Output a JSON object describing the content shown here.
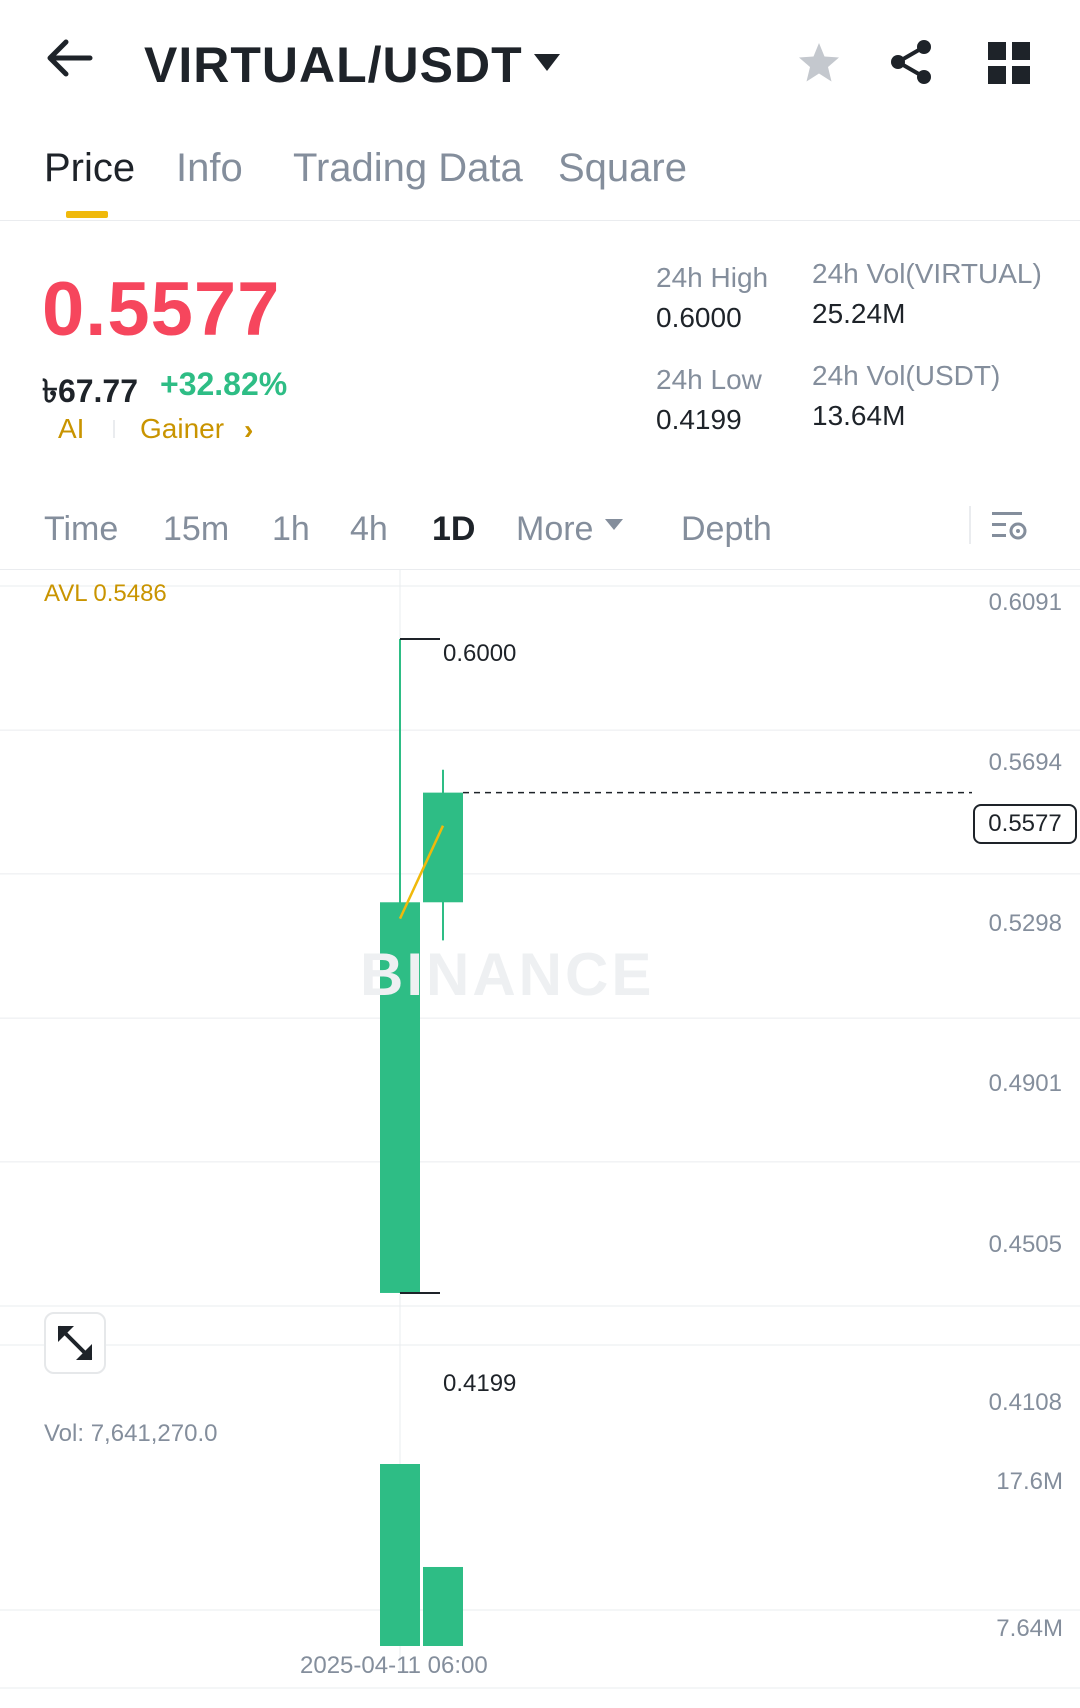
{
  "header": {
    "pair": "VIRTUAL/USDT",
    "icons": [
      "back-arrow-icon",
      "caret-down-icon",
      "star-icon",
      "share-icon",
      "grid-icon"
    ]
  },
  "tabs": [
    {
      "label": "Price",
      "active": true
    },
    {
      "label": "Info",
      "active": false
    },
    {
      "label": "Trading Data",
      "active": false
    },
    {
      "label": "Square",
      "active": false
    }
  ],
  "ticker": {
    "last_price": "0.5577",
    "fiat_price": "৳67.77",
    "change_pct": "+32.82%",
    "tags": [
      "AI",
      "Gainer"
    ],
    "tag_chevron": "›",
    "high_label": "24h High",
    "high_value": "0.6000",
    "low_label": "24h Low",
    "low_value": "0.4199",
    "vol_base_label": "24h Vol(VIRTUAL)",
    "vol_base_value": "25.24M",
    "vol_quote_label": "24h Vol(USDT)",
    "vol_quote_value": "13.64M"
  },
  "intervals": [
    {
      "label": "Time",
      "active": false
    },
    {
      "label": "15m",
      "active": false
    },
    {
      "label": "1h",
      "active": false
    },
    {
      "label": "4h",
      "active": false
    },
    {
      "label": "1D",
      "active": true
    },
    {
      "label": "More",
      "active": false
    },
    {
      "label": "Depth",
      "active": false
    }
  ],
  "chart": {
    "avl_label": "AVL 0.5486",
    "watermark": "BINANCE",
    "current_price_tag": "0.5577",
    "high_marker": "0.6000",
    "low_marker": "0.4199",
    "vol_label": "Vol: 7,641,270.0",
    "date_label": "2025-04-11 06:00"
  },
  "chart_data": {
    "type": "candlestick",
    "price_axis_ticks": [
      "0.6091",
      "0.5694",
      "0.5298",
      "0.4901",
      "0.4505",
      "0.4108"
    ],
    "volume_axis_ticks": [
      "17.6M",
      "7.64M"
    ],
    "ylim": [
      0.4108,
      0.6091
    ],
    "candles": [
      {
        "open": 0.4199,
        "high": 0.6,
        "low": 0.4199,
        "close": 0.5275,
        "volume": 17600000,
        "color": "#2ebd85"
      },
      {
        "open": 0.5275,
        "high": 0.564,
        "low": 0.517,
        "close": 0.5577,
        "volume": 7641270,
        "color": "#2ebd85"
      }
    ],
    "avl_line": [
      0.523,
      0.5486
    ],
    "avl_color": "#f0b90b",
    "grid": true
  }
}
